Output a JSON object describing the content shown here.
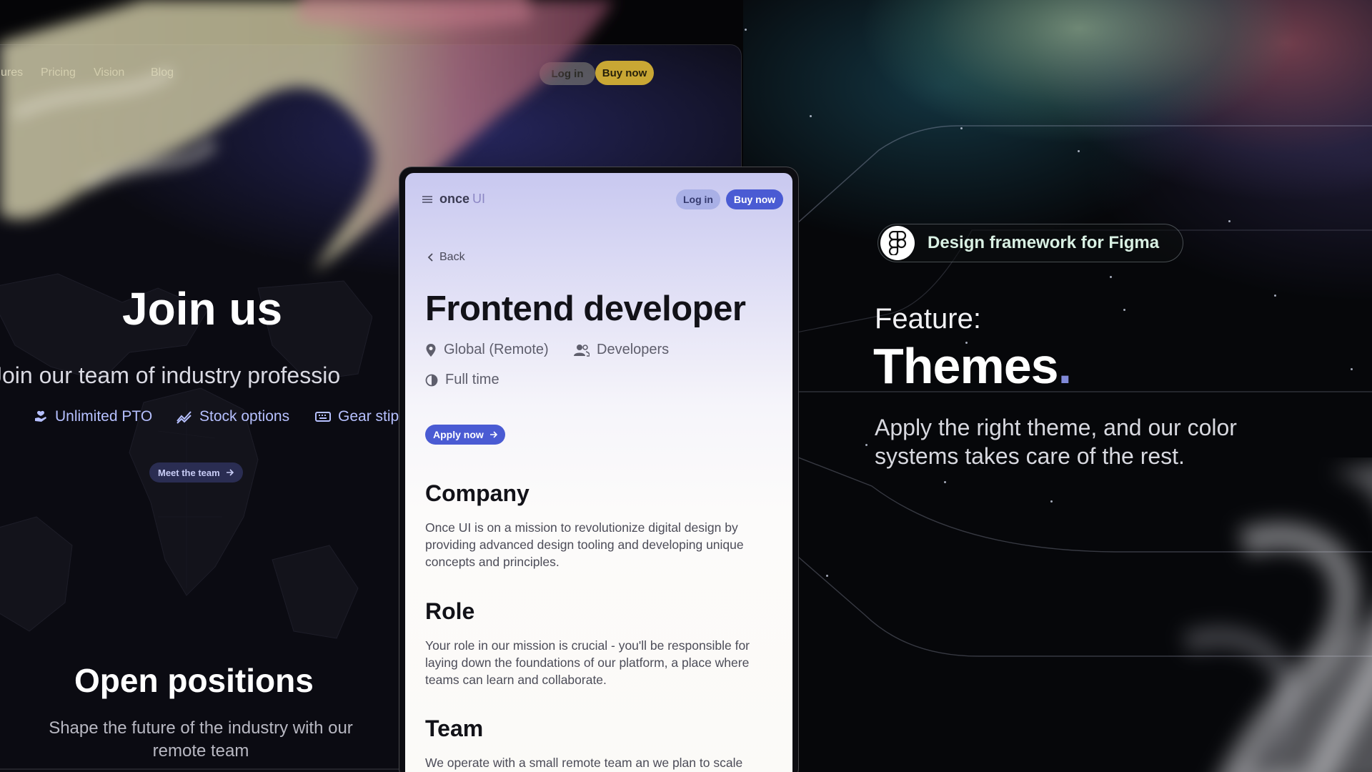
{
  "right_panel": {
    "badge_label": "Design framework for Figma",
    "kicker": "Feature:",
    "title": "Themes",
    "title_accent": ".",
    "description": "Apply the right theme, and our color systems takes care of the rest.",
    "accent_color": "#8089d8"
  },
  "left_window": {
    "nav": {
      "links": [
        "ures",
        "Pricing",
        "Vision",
        "Blog"
      ],
      "login_label": "Log in",
      "buy_label": "Buy now",
      "buy_color": "#c9a734"
    },
    "hero_title": "Join us",
    "hero_subtitle": "Join our team of industry professio",
    "perks": [
      {
        "label": "Unlimited PTO",
        "icon": "hand-heart-icon"
      },
      {
        "label": "Stock options",
        "icon": "chart-icon"
      },
      {
        "label": "Gear stip",
        "icon": "keyboard-icon"
      }
    ],
    "meet_button_label": "Meet the team",
    "open_title": "Open positions",
    "open_subtitle": "Shape the future of the industry with our remote team"
  },
  "phone": {
    "brand_once": "once",
    "brand_ui": "UI",
    "login_label": "Log in",
    "buy_label": "Buy now",
    "back_label": "Back",
    "job_title": "Frontend developer",
    "location": "Global (Remote)",
    "department": "Developers",
    "employment": "Full time",
    "apply_label": "Apply now",
    "accent_color": "#4a5bd3",
    "sections": [
      {
        "heading": "Company",
        "body": "Once UI is on a mission to revolutionize digital design by providing advanced design tooling and developing unique concepts and principles."
      },
      {
        "heading": "Role",
        "body": "Your role in our mission is crucial - you'll be responsible for laying down the foundations of our platform, a place where teams can learn and collaborate."
      },
      {
        "heading": "Team",
        "body": "We operate with a small remote team an we plan to scale"
      }
    ]
  }
}
